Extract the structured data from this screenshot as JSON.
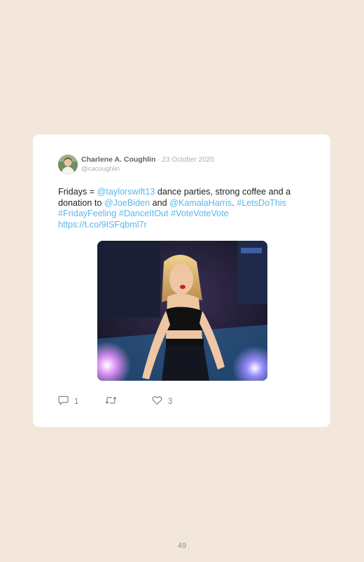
{
  "tweet": {
    "author_name": "Charlene A. Coughlin",
    "date": "23 October 2020",
    "handle": "@cacoughlin",
    "text_parts": {
      "p1": "Fridays = ",
      "m1": "@taylorswift13",
      "p2": " dance parties, strong coffee and a donation to ",
      "m2": "@JoeBiden",
      "p3": " and ",
      "m3": "@KamalaHarris",
      "p4": ". ",
      "h1": "#LetsDoThis",
      "sp1": " ",
      "h2": "#FridayFeeling",
      "sp2": " ",
      "h3": "#DanceItOut",
      "sp3": " ",
      "h4": "#VoteVoteVote",
      "sp4": " ",
      "url": "https://t.co/9ISFqbml7r"
    },
    "reply_count": "1",
    "retweet_count": "",
    "like_count": "3"
  },
  "colors": {
    "page_bg": "#f3e7dc",
    "card_bg": "#ffffff",
    "link": "#5bb6ea"
  },
  "icons": {
    "reply": "reply-icon",
    "retweet": "retweet-icon",
    "like": "heart-icon"
  },
  "page": {
    "number": "49"
  }
}
